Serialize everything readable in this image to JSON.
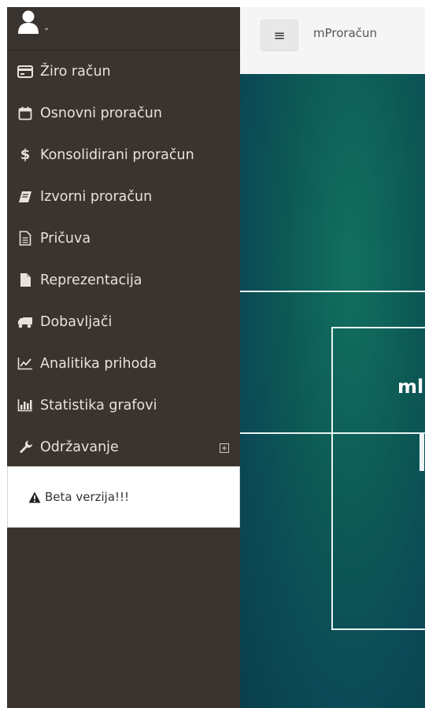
{
  "sidebar": {
    "items": [
      {
        "label": "Žiro račun",
        "icon": "credit-card-icon"
      },
      {
        "label": "Osnovni proračun",
        "icon": "calendar-icon"
      },
      {
        "label": "Konsolidirani proračun",
        "icon": "dollar-icon"
      },
      {
        "label": "Izvorni proračun",
        "icon": "book-icon"
      },
      {
        "label": "Pričuva",
        "icon": "file-text-icon"
      },
      {
        "label": "Reprezentacija",
        "icon": "file-icon"
      },
      {
        "label": "Dobavljači",
        "icon": "truck-icon"
      },
      {
        "label": "Analitika prihoda",
        "icon": "line-chart-icon"
      },
      {
        "label": "Statistika grafovi",
        "icon": "bar-chart-icon"
      },
      {
        "label": "Održavanje",
        "icon": "wrench-icon",
        "expandable": true
      }
    ],
    "beta_notice": "Beta verzija!!!"
  },
  "topbar": {
    "menu_icon": "≡",
    "app_title": "mProračun"
  },
  "hero": {
    "title_fragment": "ml"
  },
  "colors": {
    "sidebar_bg": "#3a3430",
    "sidebar_text": "#e8e2dd",
    "topbar_bg": "#f5f5f5",
    "hero_teal": "#0d5a55"
  }
}
